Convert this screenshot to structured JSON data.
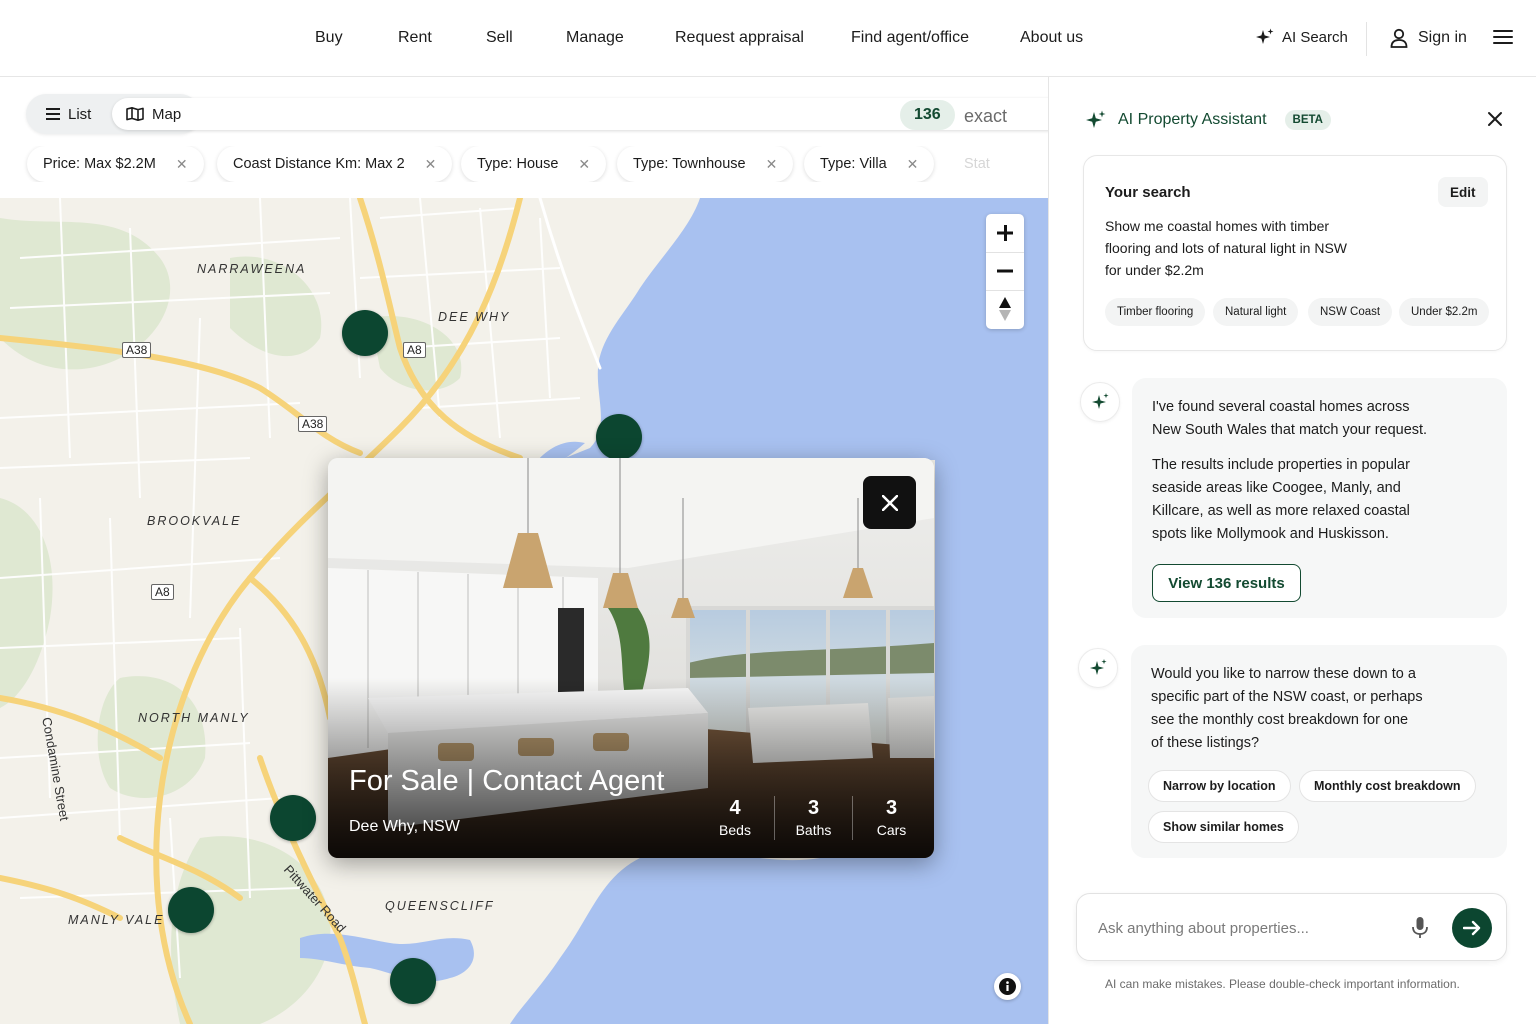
{
  "nav": {
    "items": [
      "Buy",
      "Rent",
      "Sell",
      "Manage",
      "Request appraisal",
      "Find agent/office",
      "About us"
    ],
    "ai_search": "AI Search",
    "sign_in": "Sign in"
  },
  "view_toggle": {
    "list": "List",
    "map": "Map",
    "selected": "Map"
  },
  "results": {
    "count": "136",
    "label": "exact"
  },
  "filters": [
    "Price: Max $2.2M",
    "Coast Distance Km: Max 2",
    "Type: House",
    "Type: Townhouse",
    "Type: Villa",
    "Stat"
  ],
  "map": {
    "areas": [
      "NARRAWEENA",
      "DEE WHY",
      "BROOKVALE",
      "NORTH MANLY",
      "MANLY VALE",
      "QUEENSCLIFF"
    ],
    "roads": [
      "A38",
      "A8",
      "A38",
      "A8"
    ],
    "streets": [
      "Condamine Street",
      "Pittwater Road"
    ],
    "colors": {
      "water": "#a8c1f0",
      "land": "#f3f1ea",
      "park": "#dfe8d2",
      "major_road": "#f6d37a",
      "marker": "#0c4630"
    }
  },
  "property_card": {
    "headline": "For Sale | Contact Agent",
    "suburb": "Dee Why, NSW",
    "beds": "4",
    "beds_label": "Beds",
    "baths": "3",
    "baths_label": "Baths",
    "cars": "3",
    "cars_label": "Cars"
  },
  "assistant": {
    "title": "AI Property Assistant",
    "badge": "BETA",
    "your_search": {
      "heading": "Your search",
      "edit": "Edit",
      "query": "Show me coastal homes with timber flooring and lots of natural light in NSW for under $2.2m",
      "tags": [
        "Timber flooring",
        "Natural light",
        "NSW Coast",
        "Under $2.2m"
      ]
    },
    "messages": [
      {
        "p1": "I've found several coastal homes across New South Wales that match your request.",
        "p2": "The results include properties in popular seaside areas like Coogee, Manly, and Killcare, as well as more relaxed coastal spots like Mollymook and Huskisson.",
        "button": "View 136 results"
      },
      {
        "p1": "Would you like to narrow these down to a specific part of the NSW coast, or perhaps see the monthly cost breakdown for one of these listings?",
        "suggestions": [
          "Narrow by location",
          "Monthly cost breakdown",
          "Show similar homes"
        ]
      }
    ],
    "input_placeholder": "Ask anything about properties...",
    "disclaimer": "AI can make mistakes. Please double-check important information."
  }
}
